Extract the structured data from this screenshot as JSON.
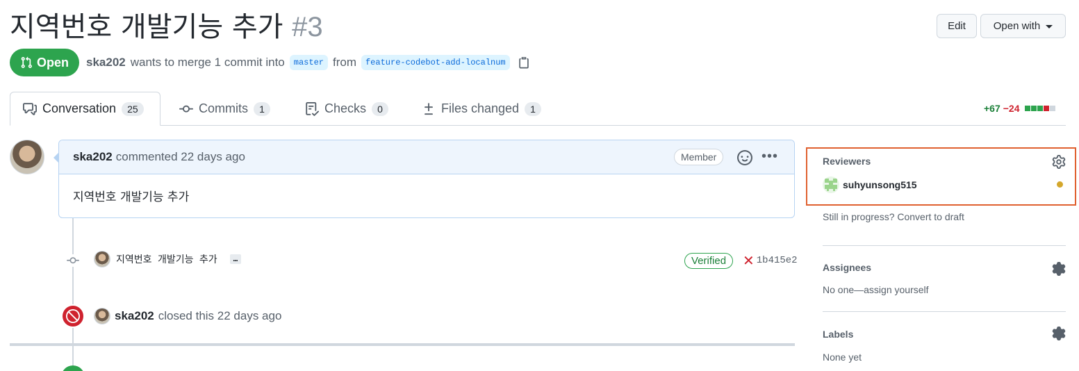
{
  "header": {
    "title": "지역번호 개발기능 추가",
    "number": "#3",
    "edit_label": "Edit",
    "open_with_label": "Open with"
  },
  "pr_meta": {
    "state": "Open",
    "author": "ska202",
    "text_merge": "wants to merge 1 commit into",
    "base_branch": "master",
    "text_from": "from",
    "head_branch": "feature-codebot-add-localnum"
  },
  "tabs": [
    {
      "label": "Conversation",
      "count": "25",
      "icon": "comment-discussion-icon"
    },
    {
      "label": "Commits",
      "count": "1",
      "icon": "git-commit-icon"
    },
    {
      "label": "Checks",
      "count": "0",
      "icon": "checklist-icon"
    },
    {
      "label": "Files changed",
      "count": "1",
      "icon": "diff-icon"
    }
  ],
  "diffstat": {
    "additions": "+67",
    "deletions": "−24",
    "colors": {
      "add": "#2da44e",
      "del": "#cf222e",
      "neutral": "#d0d7de"
    }
  },
  "comment": {
    "author": "ska202",
    "action": "commented 22 days ago",
    "role": "Member",
    "body": "지역번호 개발기능 추가"
  },
  "commit": {
    "message": "지역번호 개발기능 추가",
    "more": "…",
    "verified": "Verified",
    "sha": "1b415e2"
  },
  "closed_event": {
    "author": "ska202",
    "text": "closed this 22 days ago"
  },
  "sidebar": {
    "reviewers": {
      "heading": "Reviewers",
      "user": "suhyunsong515",
      "status_color": "#d4a72c",
      "draft_hint": "Still in progress? Convert to draft"
    },
    "assignees": {
      "heading": "Assignees",
      "value": "No one—assign yourself"
    },
    "labels": {
      "heading": "Labels",
      "value": "None yet"
    }
  }
}
